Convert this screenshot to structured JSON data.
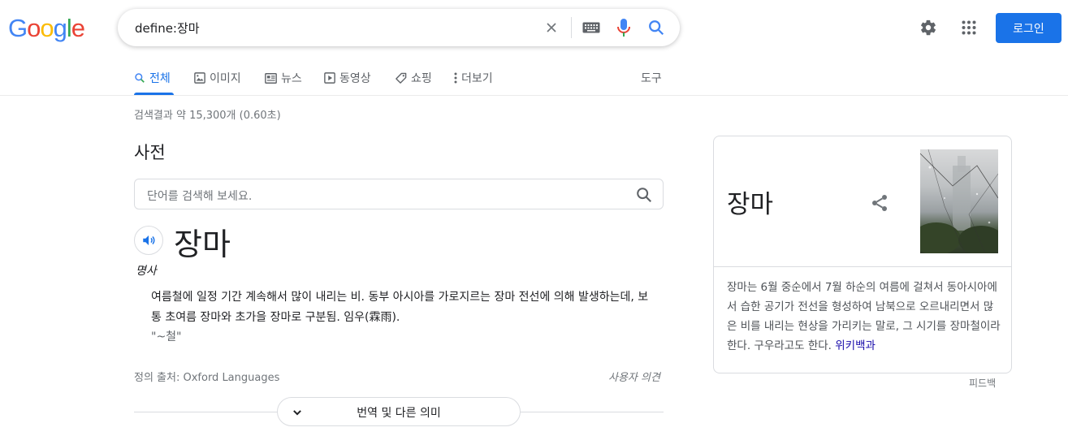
{
  "logo": {
    "letters": [
      "G",
      "o",
      "o",
      "g",
      "l",
      "e"
    ],
    "colors": [
      "#4285f4",
      "#ea4335",
      "#fbbc05",
      "#4285f4",
      "#34a853",
      "#ea4335"
    ]
  },
  "search": {
    "query": "define:장마"
  },
  "header": {
    "login_label": "로그인"
  },
  "tabs": [
    {
      "label": "전체",
      "icon": "search-icon",
      "active": true
    },
    {
      "label": "이미지",
      "icon": "image-icon"
    },
    {
      "label": "뉴스",
      "icon": "news-icon"
    },
    {
      "label": "동영상",
      "icon": "video-icon"
    },
    {
      "label": "쇼핑",
      "icon": "tag-icon"
    },
    {
      "label": "더보기",
      "icon": "more-vert-icon"
    }
  ],
  "tools_label": "도구",
  "stats": "검색결과 약 15,300개 (0.60초)",
  "dictionary": {
    "title": "사전",
    "search_placeholder": "단어를 검색해 보세요.",
    "headword": "장마",
    "part_of_speech": "명사",
    "definition": "여름철에 일정 기간 계속해서 많이 내리는 비. 동부 아시아를 가로지르는 장마 전선에 의해 발생하는데, 보통 초여름 장마와 초가을 장마로 구분됨. 임우(霖雨).",
    "example": "\"~철\"",
    "source": "정의 출처: Oxford Languages",
    "user_feedback": "사용자 의견",
    "more_label": "번역 및 다른 의미"
  },
  "knowledge_panel": {
    "title": "장마",
    "description": "장마는 6월 중순에서 7월 하순의 여름에 걸쳐서 동아시아에서 습한 공기가 전선을 형성하여 남북으로 오르내리면서 많은 비를 내리는 현상을 가리키는 말로, 그 시기를 장마철이라 한다. 구우라고도 한다.",
    "source_link": "위키백과",
    "feedback": "피드백"
  },
  "colors": {
    "accent": "#1a73e8",
    "text": "#202124",
    "muted": "#70757a",
    "link": "#1a0dab"
  }
}
